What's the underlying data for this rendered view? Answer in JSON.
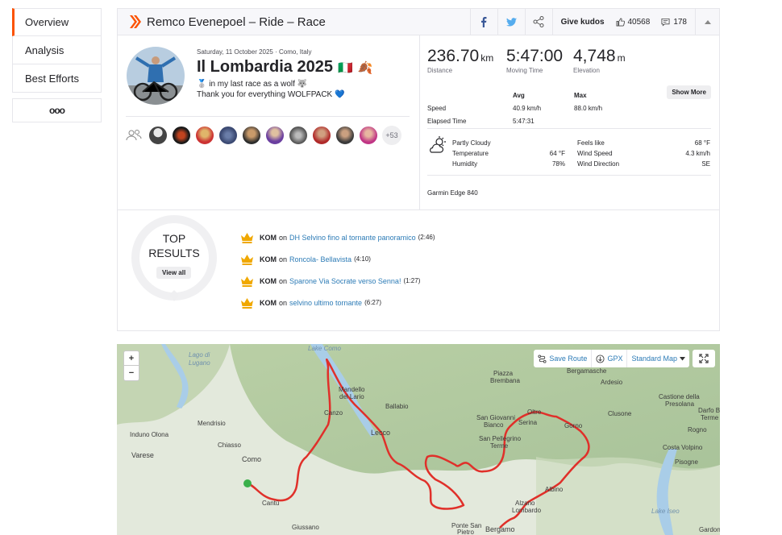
{
  "sidebar": {
    "items": [
      {
        "label": "Overview",
        "active": true
      },
      {
        "label": "Analysis"
      },
      {
        "label": "Best Efforts"
      }
    ],
    "more_label": "ooo"
  },
  "header": {
    "title": "Remco Evenepoel – Ride – Race",
    "give_kudos": "Give kudos",
    "kudos_count": "40568",
    "comment_count": "178"
  },
  "activity": {
    "date_line": "Saturday, 11 October 2025 · Como, Italy",
    "name": "Il Lombardia 2025",
    "emoji_flag": "🇮🇹",
    "emoji_leaf": "🍂",
    "description_line1": "🥈 in my last race as a wolf 🐺",
    "description_line2": "Thank you for everything WOLFPACK 💙",
    "more_athletes": "+53"
  },
  "stats": {
    "distance": {
      "value": "236.70",
      "unit": "km",
      "label": "Distance"
    },
    "moving_time": {
      "value": "5:47:00",
      "label": "Moving Time"
    },
    "elevation": {
      "value": "4,748",
      "unit": "m",
      "label": "Elevation"
    },
    "show_more": "Show More",
    "table": {
      "avg_header": "Avg",
      "max_header": "Max",
      "speed_label": "Speed",
      "speed_avg": "40.9 km/h",
      "speed_max": "88.0 km/h",
      "elapsed_label": "Elapsed Time",
      "elapsed_value": "5:47:31"
    }
  },
  "weather": {
    "condition": "Partly Cloudy",
    "temperature_label": "Temperature",
    "temperature_value": "64 °F",
    "humidity_label": "Humidity",
    "humidity_value": "78%",
    "feels_like_label": "Feels like",
    "feels_like_value": "68 °F",
    "wind_speed_label": "Wind Speed",
    "wind_speed_value": "4.3 km/h",
    "wind_direction_label": "Wind Direction",
    "wind_direction_value": "SE"
  },
  "device": "Garmin Edge 840",
  "top_results": {
    "title_line1": "TOP",
    "title_line2": "RESULTS",
    "view_all": "View all",
    "items": [
      {
        "tag": "KOM",
        "on": "on",
        "segment": "DH Selvino fino al tornante panoramico",
        "time": "(2:46)"
      },
      {
        "tag": "KOM",
        "on": "on",
        "segment": "Roncola- Bellavista",
        "time": "(4:10)"
      },
      {
        "tag": "KOM",
        "on": "on",
        "segment": "Sparone Via Socrate verso Senna!",
        "time": "(1:27)"
      },
      {
        "tag": "KOM",
        "on": "on",
        "segment": "selvino ultimo tornante",
        "time": "(6:27)"
      }
    ]
  },
  "map": {
    "zoom_in": "+",
    "zoom_out": "−",
    "save_route": "Save Route",
    "gpx": "GPX",
    "map_type": "Standard Map",
    "labels": {
      "lake_como": "Lake Como",
      "lago_di_lugano": "Lago di",
      "lugano": "Lugano",
      "mendrisio": "Mendrisio",
      "induno_olona": "Induno Olona",
      "chiasso": "Chiasso",
      "varese": "Varese",
      "como": "Como",
      "cantu": "Cantù",
      "giussano": "Giussano",
      "mandello": "Mandello",
      "del_lario": "del Lario",
      "ballabio": "Ballabio",
      "lecco": "Lecco",
      "canzo": "Canzo",
      "piazza": "Piazza",
      "brembana": "Brembana",
      "bergamasche": "Bergamasche",
      "ardesio": "Ardesio",
      "clusone": "Clusone",
      "castione": "Castione della",
      "presolana": "Presolana",
      "darfo": "Darfo B",
      "terme_r": "Terme",
      "rogno": "Rogno",
      "costa_volpino": "Costa Volpino",
      "pisogne": "Pisogne",
      "lake_iseo": "Lake Iseo",
      "san_giovanni": "San Giovanni",
      "bianco": "Bianco",
      "san_pellegrino": "San Pellegrino",
      "terme": "Terme",
      "oltre": "Oltre",
      "serina": "Serina",
      "gorno": "Gorno",
      "albino": "Albino",
      "alzano": "Alzano",
      "lombardo": "Lombardo",
      "ponte_san": "Ponte San",
      "pietro": "Pietro",
      "bergamo": "Bergamo",
      "gardone": "Gardon"
    }
  },
  "colors": {
    "brand": "#fc5200",
    "route": "#e0302a",
    "link": "#2c7bb6",
    "kom_gold": "#f0a800"
  }
}
